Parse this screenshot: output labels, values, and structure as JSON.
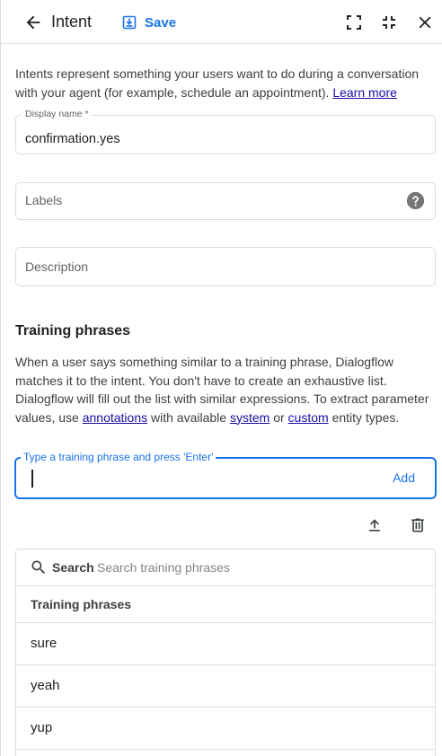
{
  "header": {
    "title": "Intent",
    "save_label": "Save",
    "icons": {
      "back": "arrow-back-icon",
      "save": "save-icon",
      "fullscreen": "fullscreen-icon",
      "exit_fullscreen": "fullscreen-exit-icon",
      "close": "close-icon"
    }
  },
  "intro": {
    "text": "Intents represent something your users want to do during a conversation with your agent (for example, schedule an appointment).",
    "link": "Learn more"
  },
  "display_name": {
    "label": "Display name *",
    "value": "confirmation.yes"
  },
  "labels_field": {
    "placeholder": "Labels",
    "help_icon": "help-circle-icon"
  },
  "description_field": {
    "placeholder": "Description"
  },
  "training": {
    "title": "Training phrases",
    "desc_part1": "When a user says something similar to a training phrase, Dialogflow matches it to the intent. You don't have to create an exhaustive list. Dialogflow will fill out the list with similar expressions. To extract parameter values, use",
    "link_annotations": "annotations",
    "desc_part2": "with available",
    "link_system": "system",
    "desc_part3": "or",
    "link_custom": "custom",
    "desc_part4": "entity types.",
    "input_label": "Type a training phrase and press 'Enter'",
    "add_label": "Add",
    "search_label": "Search",
    "search_placeholder": "Search training phrases",
    "column_header": "Training phrases",
    "phrases": [
      "sure",
      "yeah",
      "yup"
    ]
  },
  "colors": {
    "accent": "#1a73e8",
    "link": "#1a0dab",
    "border": "#dadce0"
  }
}
